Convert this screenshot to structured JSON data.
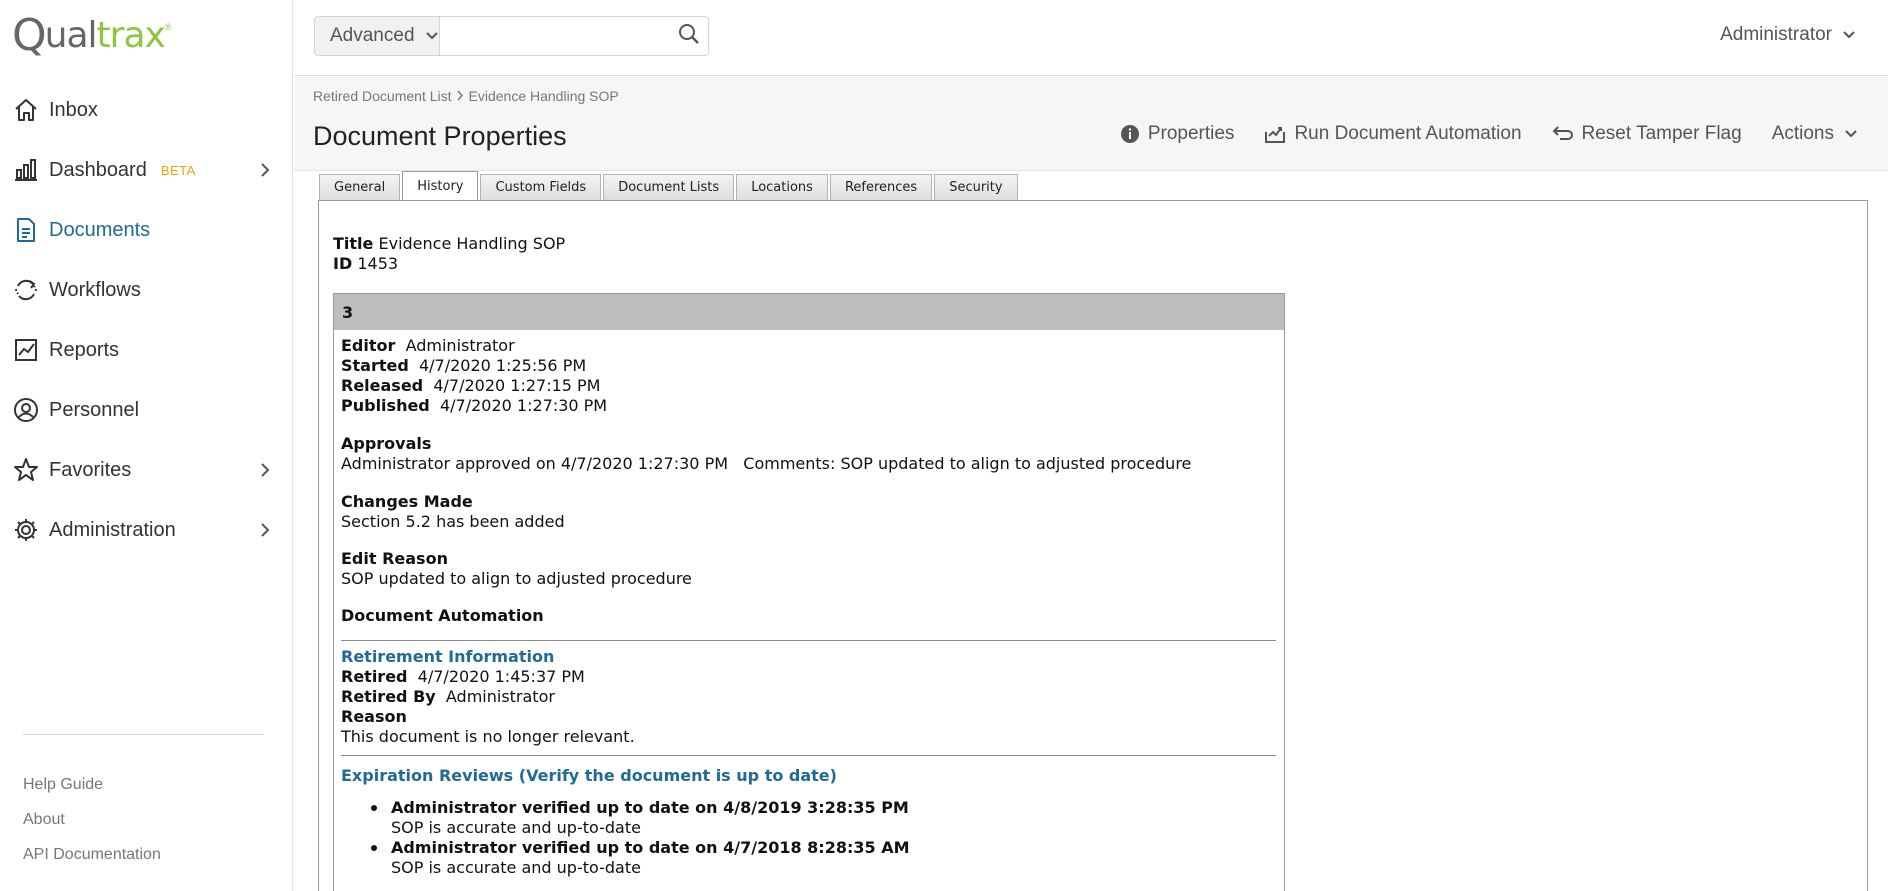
{
  "brand": {
    "logo_text": "Qualtrax"
  },
  "sidebar": {
    "items": [
      {
        "label": "Inbox",
        "icon": "home-icon"
      },
      {
        "label": "Dashboard",
        "badge": "BETA",
        "icon": "chart-icon"
      },
      {
        "label": "Documents",
        "icon": "document-icon",
        "active": true
      },
      {
        "label": "Workflows",
        "icon": "cycle-icon"
      },
      {
        "label": "Reports",
        "icon": "report-icon"
      },
      {
        "label": "Personnel",
        "icon": "user-icon"
      },
      {
        "label": "Favorites",
        "icon": "star-icon"
      },
      {
        "label": "Administration",
        "icon": "gear-icon"
      }
    ],
    "footer_links": [
      "Help Guide",
      "About",
      "API Documentation"
    ]
  },
  "topbar": {
    "search_mode": "Advanced",
    "search_value": "",
    "user": "Administrator"
  },
  "header": {
    "breadcrumb": [
      "Retired Document List",
      "Evidence Handling SOP"
    ],
    "title": "Document Properties",
    "actions": [
      "Properties",
      "Run Document Automation",
      "Reset Tamper Flag",
      "Actions"
    ]
  },
  "tabs": [
    "General",
    "History",
    "Custom Fields",
    "Document Lists",
    "Locations",
    "References",
    "Security"
  ],
  "active_tab": "History",
  "document": {
    "title_label": "Title",
    "title": "Evidence Handling SOP",
    "id_label": "ID",
    "id": "1453"
  },
  "version": {
    "number": "3",
    "editor_label": "Editor",
    "editor": "Administrator",
    "started_label": "Started",
    "started": "4/7/2020 1:25:56 PM",
    "released_label": "Released",
    "released": "4/7/2020 1:27:15 PM",
    "published_label": "Published",
    "published": "4/7/2020 1:27:30 PM",
    "approvals_label": "Approvals",
    "approvals": "Administrator approved on 4/7/2020 1:27:30 PM   Comments: SOP updated to align to adjusted procedure",
    "changes_label": "Changes Made",
    "changes": "Section 5.2 has been added",
    "edit_reason_label": "Edit Reason",
    "edit_reason": "SOP updated to align to adjusted procedure",
    "automation_label": "Document Automation",
    "retirement_label": "Retirement Information",
    "retired_label": "Retired",
    "retired": "4/7/2020 1:45:37 PM",
    "retired_by_label": "Retired By",
    "retired_by": "Administrator",
    "reason_label": "Reason",
    "reason": "This document is no longer relevant.",
    "expiration_label": "Expiration Reviews (Verify the document is up to date)",
    "expiration_reviews": [
      {
        "title": "Administrator verified up to date on 4/8/2019 3:28:35 PM",
        "note": "SOP is accurate and up-to-date"
      },
      {
        "title": "Administrator verified up to date on 4/7/2018 8:28:35 AM",
        "note": "SOP is accurate and up-to-date"
      }
    ]
  },
  "colors": {
    "accent": "#1f6b94",
    "brand_green": "#8dc63f",
    "beta": "#f0a30a",
    "version_header": "#bdbec0"
  }
}
